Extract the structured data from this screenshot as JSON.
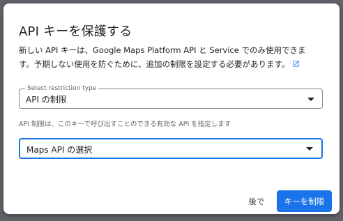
{
  "dialog": {
    "title": "API キーを保護する",
    "description": "新しい API キーは、Google Maps Platform API と Service でのみ使用できます。予期しない使用を防ぐために、追加の制限を設定する必要があります。",
    "description_link_icon": "external-link-icon"
  },
  "restriction_type": {
    "label": "Select restriction type",
    "value": "API の制限"
  },
  "hint": "API 制限は、このキーで呼び出すことのできる有効な API を指定します",
  "api_select": {
    "value": "Maps API の選択"
  },
  "buttons": {
    "later": "後で",
    "restrict_key": "キーを制限"
  },
  "colors": {
    "primary": "#1a73e8",
    "text": "#202124",
    "secondary_text": "#5f6368",
    "backdrop": "#5f6368"
  }
}
